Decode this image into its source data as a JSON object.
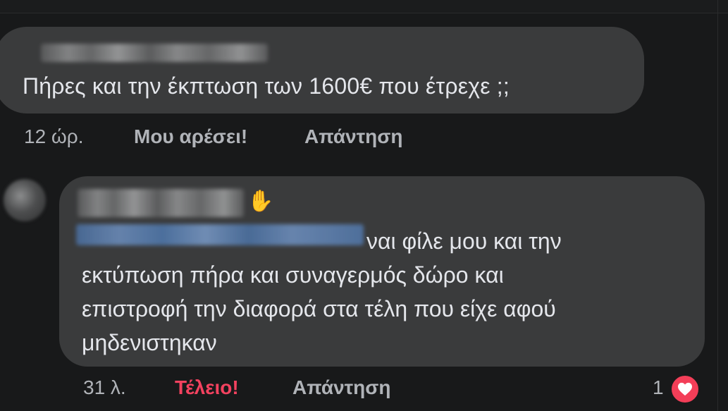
{
  "comment1": {
    "text": "Πήρες και την έκπτωση των 1600€ που έτρεχε ;;",
    "time": "12 ώρ.",
    "like_label": "Μου αρέσει!",
    "reply_label": "Απάντηση"
  },
  "comment2": {
    "lines": [
      "ναι φίλε μου και την",
      "εκτύπωση πήρα και συναγερμός δώρο και",
      "επιστροφή την διαφορά στα τέλη που είχε αφού",
      "μηδενιστηκαν"
    ],
    "time": "31 λ.",
    "reaction_label": "Τέλειο!",
    "reply_label": "Απάντηση",
    "reaction_count": "1"
  },
  "icons": {
    "wave": "waving-hand-icon",
    "heart": "heart-icon"
  },
  "colors": {
    "background": "#18191a",
    "bubble": "#3a3b3c",
    "text": "#e4e6eb",
    "meta": "#b0b3b8",
    "love_accent": "#f3425f"
  }
}
